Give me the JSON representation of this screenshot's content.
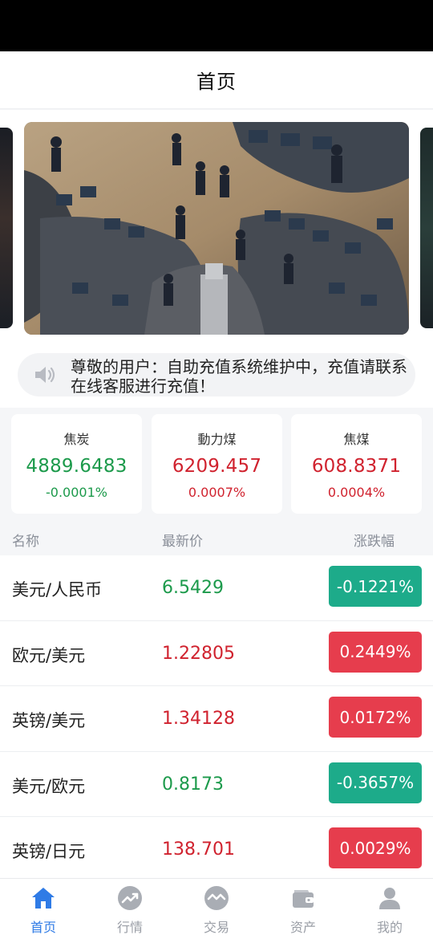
{
  "header": {
    "title": "首页"
  },
  "banner": {
    "description": "stock exchange trading floor photo"
  },
  "notice": {
    "icon": "speaker-icon",
    "text": "尊敬的用户：自助充值系统维护中，充值请联系在线客服进行充值！"
  },
  "quotes": [
    {
      "name": "焦炭",
      "price": "4889.6483",
      "change": "-0.0001%",
      "trend": "down"
    },
    {
      "name": "動力煤",
      "price": "6209.457",
      "change": "0.0007%",
      "trend": "up"
    },
    {
      "name": "焦煤",
      "price": "608.8371",
      "change": "0.0004%",
      "trend": "up"
    }
  ],
  "list": {
    "headers": {
      "name": "名称",
      "price": "最新价",
      "change": "涨跌幅"
    },
    "rows": [
      {
        "name": "美元/人民币",
        "price": "6.5429",
        "change": "-0.1221%",
        "trend": "down"
      },
      {
        "name": "欧元/美元",
        "price": "1.22805",
        "change": "0.2449%",
        "trend": "up"
      },
      {
        "name": "英镑/美元",
        "price": "1.34128",
        "change": "0.0172%",
        "trend": "up"
      },
      {
        "name": "美元/欧元",
        "price": "0.8173",
        "change": "-0.3657%",
        "trend": "down"
      },
      {
        "name": "英镑/日元",
        "price": "138.701",
        "change": "0.0029%",
        "trend": "up"
      }
    ]
  },
  "tabbar": {
    "items": [
      {
        "label": "首页",
        "icon": "home-icon",
        "active": true
      },
      {
        "label": "行情",
        "icon": "trend-chart-icon",
        "active": false
      },
      {
        "label": "交易",
        "icon": "exchange-icon",
        "active": false
      },
      {
        "label": "资产",
        "icon": "wallet-icon",
        "active": false
      },
      {
        "label": "我的",
        "icon": "user-icon",
        "active": false
      }
    ]
  },
  "colors": {
    "up": "#d0222e",
    "down": "#1c9a4b",
    "badge_up": "#e63d4d",
    "badge_down": "#1dab8a",
    "accent": "#2f7be6"
  }
}
